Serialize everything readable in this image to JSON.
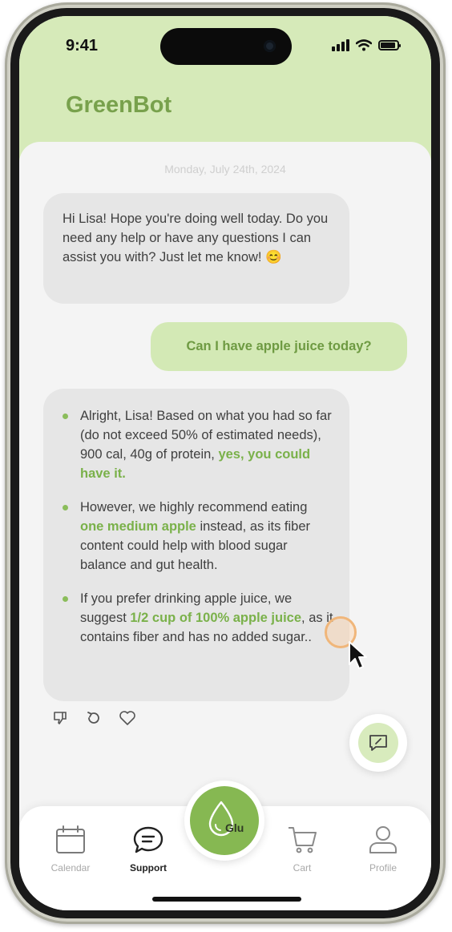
{
  "status_bar": {
    "time": "9:41"
  },
  "header": {
    "title": "GreenBot"
  },
  "chat": {
    "date": "Monday, July 24th, 2024",
    "messages": [
      {
        "from": "bot",
        "text": "Hi Lisa! Hope you're doing well today. Do you need any help or have any questions I can assist you with? Just let me know! 😊"
      },
      {
        "from": "user",
        "text": "Can I have apple juice today?"
      }
    ],
    "reply": {
      "bullets": [
        {
          "plain": "Alright, Lisa! Based on what you had so far (do not exceed 50% of estimated needs), 900 cal, 40g of protein, ",
          "highlight": "yes, you could have it",
          "after": "."
        },
        {
          "plain": "However, we highly recommend eating ",
          "highlight": "one medium apple",
          "after": " instead, as its fiber content could help with blood sugar balance and gut health."
        },
        {
          "plain": "If you prefer drinking apple juice, we suggest ",
          "highlight": "1/2 cup of 100% apple juice",
          "after": ", as it contains fiber and has no added sugar.."
        }
      ]
    },
    "actions": [
      "thumbs-down-icon",
      "retry-icon",
      "heart-icon"
    ]
  },
  "center_button": {
    "label": "Glu"
  },
  "tabs": [
    {
      "label": "Calendar",
      "icon": "calendar-icon",
      "active": false
    },
    {
      "label": "Support",
      "icon": "chat-bubble-icon",
      "active": true
    },
    {
      "label": "Cart",
      "icon": "cart-icon",
      "active": false
    },
    {
      "label": "Profile",
      "icon": "user-icon",
      "active": false
    }
  ],
  "colors": {
    "header_bg": "#d6eab9",
    "accent_green": "#78a14c",
    "bubble_bot": "#e6e6e6",
    "bubble_user": "#d3e9b5",
    "glu_button": "#86b852"
  }
}
